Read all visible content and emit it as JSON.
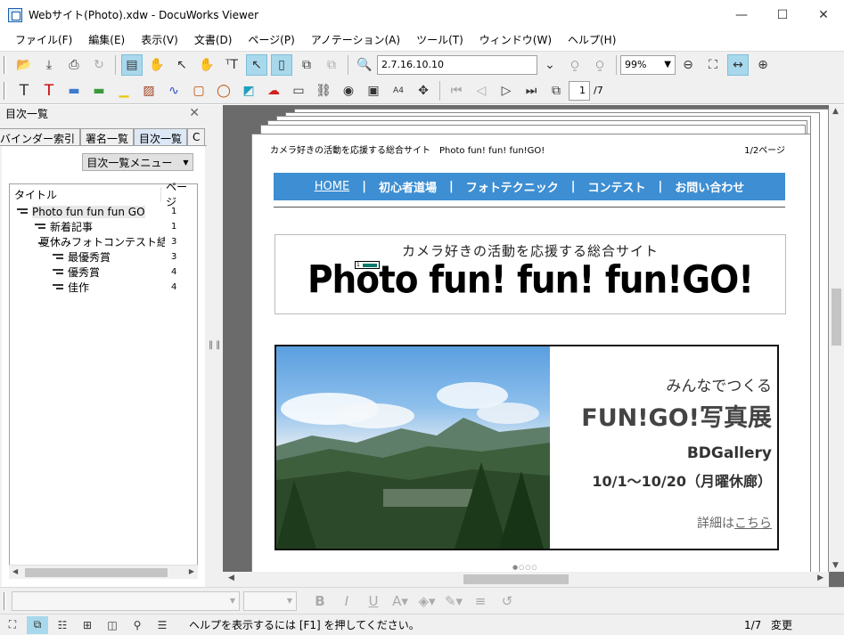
{
  "window": {
    "title": "Webサイト(Photo).xdw - DocuWorks Viewer",
    "minimize": "—",
    "maximize": "☐",
    "close": "✕"
  },
  "menu": [
    "ファイル(F)",
    "編集(E)",
    "表示(V)",
    "文書(D)",
    "ページ(P)",
    "アノテーション(A)",
    "ツール(T)",
    "ウィンドウ(W)",
    "ヘルプ(H)"
  ],
  "toolbar": {
    "search_value": "2.7.16.10.10",
    "zoom_value": "99%",
    "page_current": "1",
    "page_total": "/7"
  },
  "left_panel": {
    "header": "目次一覧",
    "tabs": [
      "バインダー索引",
      "署名一覧",
      "目次一覧",
      "C"
    ],
    "menu_button": "目次一覧メニュー",
    "col_title": "タイトル",
    "col_page": "ページ",
    "items": [
      {
        "label": "Photo fun fun fun GO",
        "page": "1",
        "level": 0
      },
      {
        "label": "新着記事",
        "page": "1",
        "level": 1
      },
      {
        "label": "夏休みフォトコンテスト結...",
        "page": "3",
        "level": 1
      },
      {
        "label": "最優秀賞",
        "page": "3",
        "level": 2
      },
      {
        "label": "優秀賞",
        "page": "4",
        "level": 2
      },
      {
        "label": "佳作",
        "page": "4",
        "level": 2
      }
    ]
  },
  "document": {
    "header_left": "カメラ好きの活動を応援する総合サイト　Photo fun! fun! fun!GO!",
    "header_right": "1/2ページ",
    "nav": [
      "HOME",
      "初心者道場",
      "フォトテクニック",
      "コンテスト",
      "お問い合わせ"
    ],
    "banner_sub": "カメラ好きの活動を応援する総合サイト",
    "banner_title": "Photo fun! fun! fun!GO!",
    "annotation_label": "1",
    "feature": {
      "line1": "みんなでつくる",
      "line2": "FUN!GO!写真展",
      "line3": "BDGallery",
      "line4": "10/1〜10/20（月曜休廊）",
      "detail_prefix": "詳細は",
      "detail_link": "こちら"
    },
    "dots": "●○○○"
  },
  "status": {
    "help_text": "ヘルプを表示するには [F1] を押してください。",
    "page": "1/7",
    "state": "変更"
  }
}
